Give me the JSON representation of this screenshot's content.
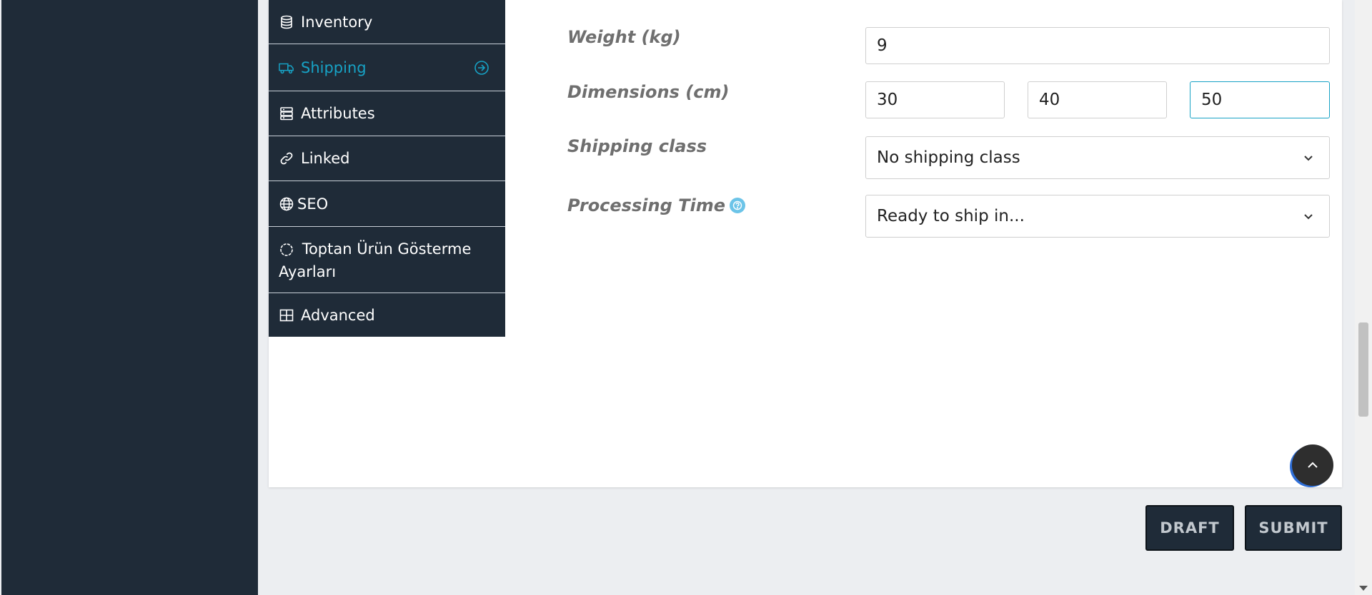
{
  "tabs": [
    {
      "label": "Inventory",
      "icon": "database-icon",
      "active": false
    },
    {
      "label": "Shipping",
      "icon": "truck-icon",
      "active": true
    },
    {
      "label": "Attributes",
      "icon": "server-icon",
      "active": false
    },
    {
      "label": "Linked",
      "icon": "link-icon",
      "active": false
    },
    {
      "label": "SEO",
      "icon": "globe-icon",
      "active": false
    },
    {
      "label": "Toptan Ürün Gösterme Ayarları",
      "icon": "circle-dashed-icon",
      "active": false
    },
    {
      "label": "Advanced",
      "icon": "grid-icon",
      "active": false
    }
  ],
  "form": {
    "weight": {
      "label": "Weight (kg)",
      "value": "9"
    },
    "dimensions": {
      "label": "Dimensions (cm)",
      "length": "30",
      "width": "40",
      "height": "50"
    },
    "shipping_class": {
      "label": "Shipping class",
      "selected": "No shipping class"
    },
    "processing_time": {
      "label": "Processing Time",
      "selected": "Ready to ship in..."
    }
  },
  "actions": {
    "draft_label": "DRAFT",
    "submit_label": "SUBMIT"
  },
  "colors": {
    "sidebar": "#1f2b38",
    "accent": "#17a2c5",
    "page_bg": "#eceef1"
  }
}
